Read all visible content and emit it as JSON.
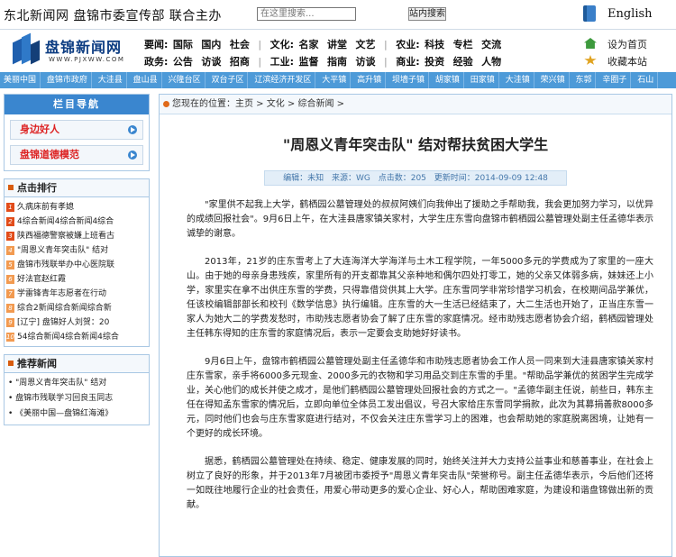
{
  "topbar": {
    "brand": "东北新闻网  盘锦市委宣传部  联合主办",
    "search_placeholder": "在这里搜索...",
    "search_button": "站内搜索",
    "language": "English"
  },
  "logo": {
    "title": "盘锦新闻网",
    "url": "WWW.PJXWW.COM"
  },
  "nav": {
    "row1": {
      "head": "要闻:",
      "g1": [
        "国际",
        "国内",
        "社会"
      ],
      "head2": "文化:",
      "g2": [
        "名家",
        "讲堂",
        "文艺"
      ],
      "head3": "农业:",
      "g3": [
        "科技",
        "专栏",
        "交流"
      ]
    },
    "row2": {
      "head": "政务:",
      "g1": [
        "公告",
        "访谈",
        "招商"
      ],
      "head2": "工业:",
      "g2": [
        "监督",
        "指南",
        "访谈"
      ],
      "head3": "商业:",
      "g3": [
        "投资",
        "经验",
        "人物"
      ]
    }
  },
  "tools": {
    "home": "设为首页",
    "favorite": "收藏本站"
  },
  "citybar": [
    "美丽中国",
    "盘锦市政府",
    "大洼县",
    "盘山县",
    "兴隆台区",
    "双台子区",
    "辽滨经济开发区",
    "大平镇",
    "高升镇",
    "坝墙子镇",
    "胡家镇",
    "田家镇",
    "大洼镇",
    "荣兴镇",
    "东郭",
    "辛圈子",
    "石山"
  ],
  "sidebar": {
    "nav_title": "栏目导航",
    "buttons": [
      "身边好人",
      "盘锦道德模范"
    ],
    "rank_title": "点击排行",
    "rank_items": [
      "久病床前有孝媳",
      "4综合新闻4综合新闻4综合",
      "陕西福德警察被嫌上班看古",
      "\"周恩义青年突击队\" 结对",
      "盘锦市残联举办中心医院联",
      "好法官赵红霞",
      "学雷锋青年志愿者在行动",
      "综合2新闻综合新闻综合新",
      "[辽宁] 盘锦好人刘贺：20",
      "54综合新闻4综合新闻4综合"
    ],
    "rec_title": "推荐新闻",
    "rec_items": [
      "\"周恩义青年突击队\" 结对",
      "盘锦市残联学习回良玉同志",
      "《美丽中国—盘锦红海滩》"
    ]
  },
  "main": {
    "breadcrumb": "您现在的位置：主页 > 文化 > 综合新闻 >",
    "title": "\"周恩义青年突击队\" 结对帮扶贫困大学生",
    "meta": {
      "editor": "编辑：未知",
      "source": "来源：WG",
      "clicks": "点击数：205",
      "updated": "更新时间：2014-09-09 12:48"
    },
    "paragraphs": [
      "\"家里供不起我上大学，鹤栖园公墓管理处的叔叔阿姨们向我伸出了援助之手帮助我，我会更加努力学习，以优异的成绩回报社会\"。9月6日上午，在大洼县唐家镇关家村，大学生庄东雪向盘锦市鹤栖园公墓管理处副主任孟德华表示诚挚的谢意。",
      "2013年，21岁的庄东雪考上了大连海洋大学海洋与土木工程学院，一年5000多元的学费成为了家里的一座大山。由于她的母亲身患残疾，家里所有的开支都靠其父亲种地和偶尔四处打零工，她的父亲又体弱多病，妹妹还上小学，家里实在拿不出供庄东雪的学费，只得靠借贷供其上大学。庄东雪同学非常珍惜学习机会，在校期间品学兼优，任该校编辑部部长和校刊《数学信息》执行编辑。庄东雪的大一生活已经结束了，大二生活也开始了，正当庄东雪一家人为她大二的学费发愁时，市助残志愿者协会了解了庄东雪的家庭情况。经市助残志愿者协会介绍，鹤栖园管理处主任韩东得知的庄东雪的家庭情况后，表示一定要会支助她好好读书。",
      "9月6日上午，盘锦市鹤栖园公墓管理处副主任孟德华和市助残志愿者协会工作人员一同来到大洼县唐家镇关家村庄东雪家，亲手将6000多元现金、2000多元的衣物和学习用品交到庄东雪的手里。\"帮助品学兼优的贫困学生完成学业，关心他们的成长并使之成才，是他们鹤栖园公墓管理处回报社会的方式之一。\"孟德华副主任说，前些日，韩东主任在得知孟东雪家的情况后，立即向单位全体员工发出倡议，号召大家给庄东雪同学捐款，此次为其募捐善款8000多元，同时他们也会与庄东雪家庭进行结对，不仅会关注庄东雪学习上的困难，也会帮助她的家庭脱离困境，让她有一个更好的成长环境。",
      "据悉，鹤栖园公墓管理处在持续、稳定、健康发展的同时，始终关注并大力支持公益事业和慈善事业，在社会上树立了良好的形象，并于2013年7月被团市委授予\"周恩义青年突击队\"荣誉称号。副主任孟德华表示，今后他们还将一如既往地履行企业的社会责任，用爱心带动更多的爱心企业、好心人，帮助困难家庭，为建设和谐盘锦做出新的贡献。"
    ]
  }
}
